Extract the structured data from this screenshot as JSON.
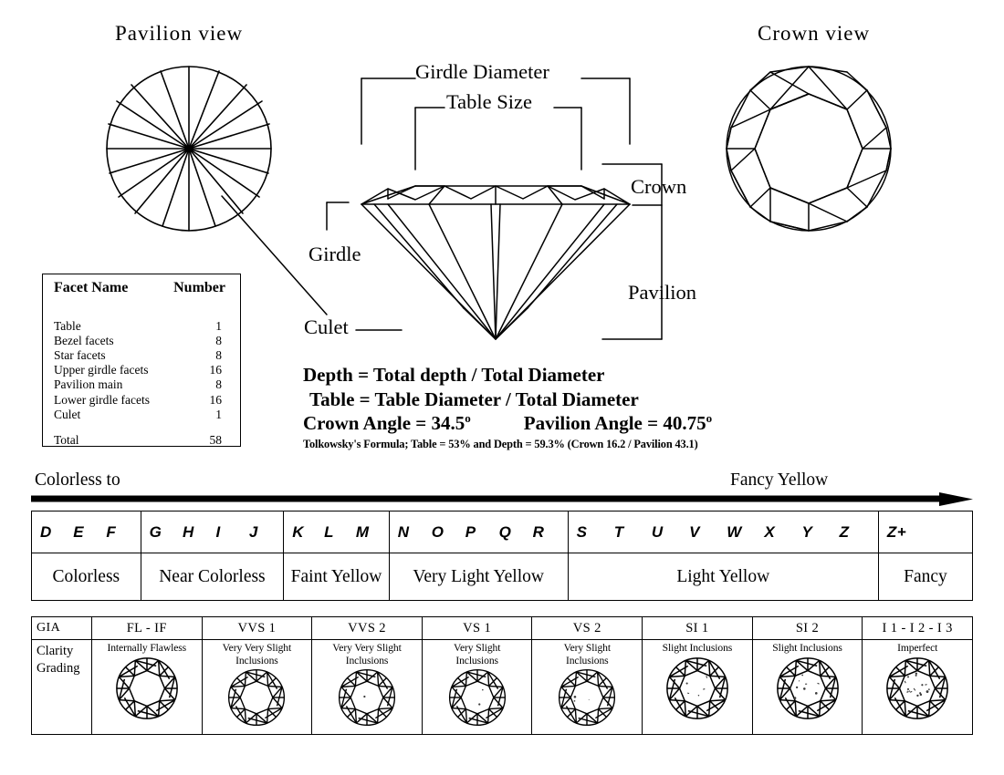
{
  "views": {
    "pavilion_title": "Pavilion  view",
    "crown_title": "Crown view"
  },
  "diamond_labels": {
    "girdle_diameter": "Girdle Diameter",
    "table_size": "Table Size",
    "crown": "Crown",
    "pavilion": "Pavilion",
    "girdle": "Girdle",
    "culet": "Culet"
  },
  "facet_table": {
    "header_name": "Facet Name",
    "header_number": "Number",
    "rows": [
      {
        "name": "Table",
        "count": "1"
      },
      {
        "name": "Bezel facets",
        "count": "8"
      },
      {
        "name": "Star facets",
        "count": "8"
      },
      {
        "name": "Upper girdle facets",
        "count": "16"
      },
      {
        "name": "Pavilion main",
        "count": "8"
      },
      {
        "name": "Lower girdle facets",
        "count": "16"
      },
      {
        "name": "Culet",
        "count": "1"
      }
    ],
    "total_label": "Total",
    "total_count": "58"
  },
  "formulas": {
    "line1": "Depth = Total depth / Total Diameter",
    "line2": "Table = Table Diameter / Total Diameter",
    "crown_angle_label": "Crown Angle = 34.5",
    "pavilion_angle_label": "Pavilion Angle = 40.75",
    "degree": "o",
    "tolkowsky": "Tolkowsky's Formula; Table = 53% and Depth = 59.3%  (Crown 16.2 / Pavilion 43.1)"
  },
  "color_scale": {
    "caption_left": "Colorless  to",
    "caption_right": "Fancy Yellow",
    "groups": [
      {
        "letters": [
          "D",
          "E",
          "F"
        ],
        "description": "Colorless",
        "width": 11.6
      },
      {
        "letters": [
          "G",
          "H",
          "I",
          "J"
        ],
        "description": "Near Colorless",
        "width": 15.2
      },
      {
        "letters": [
          "K",
          "L",
          "M"
        ],
        "description": "Faint Yellow",
        "width": 11.2
      },
      {
        "letters": [
          "N",
          "O",
          "P",
          "Q",
          "R"
        ],
        "description": "Very Light Yellow",
        "width": 19.0
      },
      {
        "letters": [
          "S",
          "T",
          "U",
          "V",
          "W",
          "X",
          "Y",
          "Z"
        ],
        "description": "Light Yellow",
        "width": 33.0
      },
      {
        "letters": [
          "Z+"
        ],
        "description": "Fancy",
        "width": 10.0
      }
    ]
  },
  "clarity": {
    "org_label": "GIA",
    "row_label_line1": "Clarity",
    "row_label_line2": "Grading",
    "columns": [
      {
        "grade": "FL - IF",
        "description": [
          "Internally Flawless"
        ],
        "inclusions": 0
      },
      {
        "grade": "VVS 1",
        "description": [
          "Very Very Slight",
          "Inclusions"
        ],
        "inclusions": 0
      },
      {
        "grade": "VVS 2",
        "description": [
          "Very Very Slight",
          "Inclusions"
        ],
        "inclusions": 1
      },
      {
        "grade": "VS 1",
        "description": [
          "Very Slight",
          "Inclusions"
        ],
        "inclusions": 2
      },
      {
        "grade": "VS 2",
        "description": [
          "Very Slight",
          "Inclusions"
        ],
        "inclusions": 3
      },
      {
        "grade": "SI 1",
        "description": [
          "Slight Inclusions"
        ],
        "inclusions": 5
      },
      {
        "grade": "SI 2",
        "description": [
          "Slight Inclusions"
        ],
        "inclusions": 8
      },
      {
        "grade": "I 1 - I 2 - I 3",
        "description": [
          "Imperfect"
        ],
        "inclusions": 16
      }
    ]
  }
}
